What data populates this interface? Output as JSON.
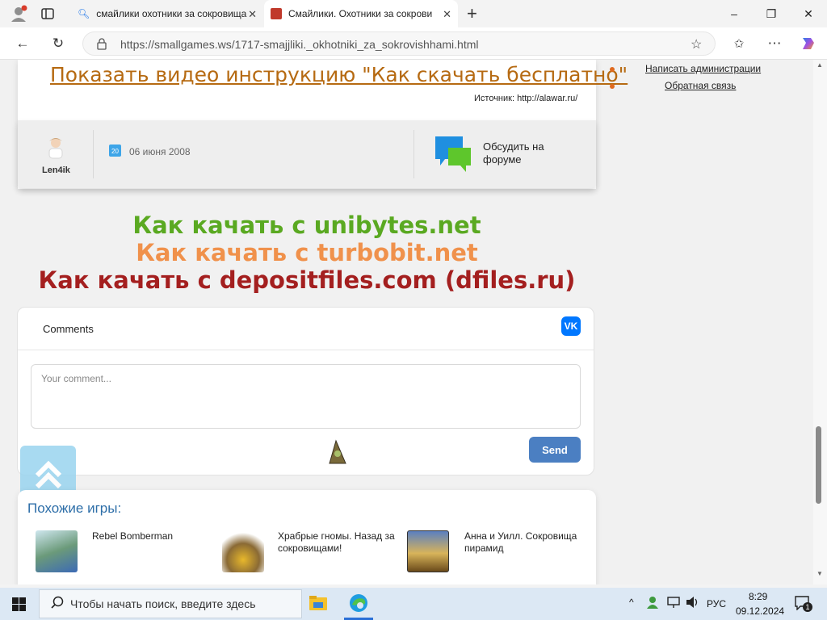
{
  "browser": {
    "tabs": [
      {
        "title": "смайлики охотники за сокровища",
        "icon": "search-icon",
        "active": false
      },
      {
        "title": "Смайлики. Охотники за сокрови",
        "icon": "alawar-favicon",
        "active": true
      }
    ],
    "new_tab": "+",
    "window_controls": {
      "minimize": "–",
      "restore": "❐",
      "close": "✕"
    },
    "url": "https://smallgames.ws/1717-smajjliki._okhotniki_za_sokrovishhami.html"
  },
  "page": {
    "video_link": "Показать видео инструкцию \"Как скачать бесплатно\"",
    "source": "Источник: http://alawar.ru/",
    "author": "Len4ik",
    "date": "06 июня 2008",
    "calendar_day": "20",
    "forum_link": "Обсудить на форуме",
    "howto": [
      {
        "text": "Как качать с unibytes.net",
        "color": "#5aa921"
      },
      {
        "text": "Как качать с turbobit.net",
        "color": "#f0914b"
      },
      {
        "text": "Как качать с depositfiles.com (dfiles.ru)",
        "color": "#a41f1f"
      }
    ],
    "comments": {
      "title": "Comments",
      "placeholder": "Your comment...",
      "send": "Send"
    },
    "similar": {
      "title": "Похожие игры:",
      "games": [
        {
          "name": "Rebel Bomberman"
        },
        {
          "name": "Храбрые гномы. Назад за сокровищами!"
        },
        {
          "name": "Анна и Уилл. Сокровища пирамид"
        }
      ]
    },
    "sidebar": [
      {
        "label": "Написать администрации"
      },
      {
        "label": "Обратная связь"
      }
    ]
  },
  "taskbar": {
    "search_placeholder": "Чтобы начать поиск, введите здесь",
    "language": "РУС",
    "time": "8:29",
    "date": "09.12.2024",
    "notification_count": "1"
  },
  "colors": {
    "accent_link": "#b66a12",
    "send_button": "#4b7fc2",
    "vk": "#0077ff"
  }
}
